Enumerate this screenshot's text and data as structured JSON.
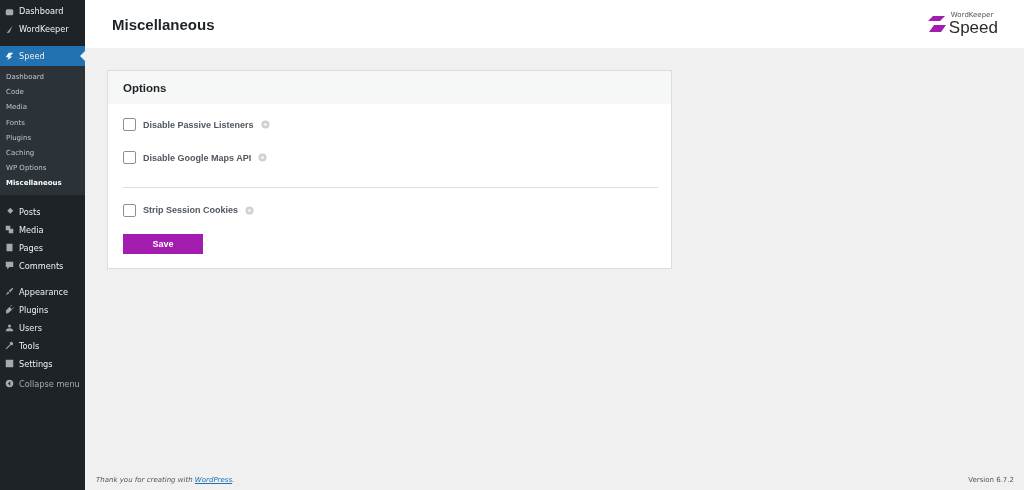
{
  "sidebar": {
    "groups": [
      {
        "items": [
          {
            "label": "Dashboard",
            "selected": false
          },
          {
            "label": "WordKeeper",
            "selected": false
          }
        ]
      },
      {
        "items": [
          {
            "label": "Speed",
            "selected": true,
            "children": [
              {
                "label": "Dashboard",
                "selected": false
              },
              {
                "label": "Code",
                "selected": false
              },
              {
                "label": "Media",
                "selected": false
              },
              {
                "label": "Fonts",
                "selected": false
              },
              {
                "label": "Plugins",
                "selected": false
              },
              {
                "label": "Caching",
                "selected": false
              },
              {
                "label": "WP Options",
                "selected": false
              },
              {
                "label": "Miscellaneous",
                "selected": true
              }
            ]
          }
        ]
      },
      {
        "items": [
          {
            "label": "Posts",
            "selected": false
          },
          {
            "label": "Media",
            "selected": false
          },
          {
            "label": "Pages",
            "selected": false
          },
          {
            "label": "Comments",
            "selected": false
          }
        ]
      },
      {
        "items": [
          {
            "label": "Appearance",
            "selected": false
          },
          {
            "label": "Plugins",
            "selected": false
          },
          {
            "label": "Users",
            "selected": false
          },
          {
            "label": "Tools",
            "selected": false
          },
          {
            "label": "Settings",
            "selected": false
          }
        ]
      }
    ],
    "collapse": "Collapse menu"
  },
  "header": {
    "title": "Miscellaneous",
    "logo_small": "WordKeeper",
    "logo_large": "Speed"
  },
  "card": {
    "title": "Options",
    "sections": [
      [
        {
          "label": "Disable Passive Listeners",
          "checked": false
        },
        {
          "label": "Disable Google Maps API",
          "checked": false
        }
      ],
      [
        {
          "label": "Strip Session Cookies",
          "checked": false
        }
      ]
    ],
    "button": "Save"
  },
  "footer": {
    "before": "Thank you for creating with ",
    "link": "WordPress",
    "after": ".",
    "version": "Version 6.7.2"
  }
}
